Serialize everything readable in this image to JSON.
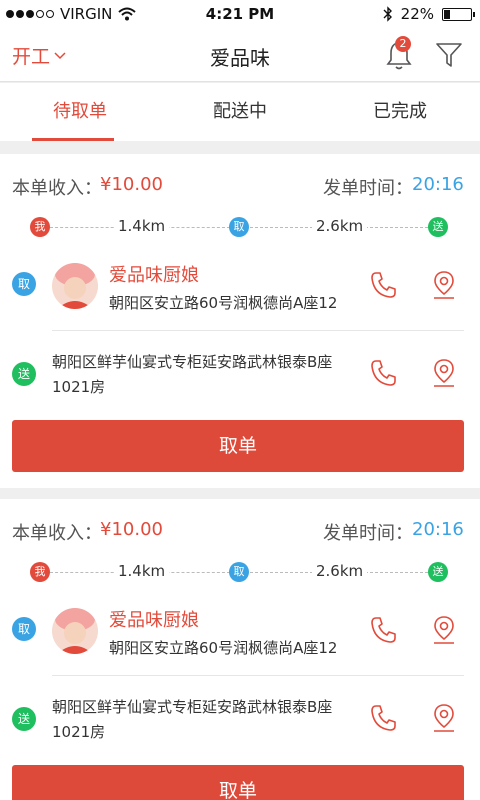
{
  "status_bar": {
    "carrier": "VIRGIN",
    "time": "4:21 PM",
    "battery": "22%",
    "battery_level": 0.22
  },
  "nav": {
    "left_label": "开工",
    "title": "爱品味",
    "notification_count": "2"
  },
  "tabs": [
    {
      "label": "待取单",
      "active": true
    },
    {
      "label": "配送中",
      "active": false
    },
    {
      "label": "已完成",
      "active": false
    }
  ],
  "orders": [
    {
      "income_label": "本单收入：",
      "income": "¥10.00",
      "time_label": "发单时间：",
      "time": "20:16",
      "route": {
        "me": "我",
        "pickup": "取",
        "deliver": "送",
        "dist1": "1.4km",
        "dist2": "2.6km"
      },
      "shop_name": "爱品味厨娘",
      "pickup_address": "朝阳区安立路60号润枫德尚A座12",
      "delivery_address_line1": "朝阳区鲜芋仙宴式专柜延安路武林银泰B座",
      "delivery_address_line2": "1021房",
      "button_label": "取单"
    },
    {
      "income_label": "本单收入：",
      "income": "¥10.00",
      "time_label": "发单时间：",
      "time": "20:16",
      "route": {
        "me": "我",
        "pickup": "取",
        "deliver": "送",
        "dist1": "1.4km",
        "dist2": "2.6km"
      },
      "shop_name": "爱品味厨娘",
      "pickup_address": "朝阳区安立路60号润枫德尚A座12",
      "delivery_address_line1": "朝阳区鲜芋仙宴式专柜延安路武林银泰B座",
      "delivery_address_line2": "1021房",
      "button_label": "取单"
    }
  ],
  "colors": {
    "accent": "#e24b3b",
    "blue": "#3aa3e3",
    "green": "#1fbf5f"
  },
  "icons": [
    "wifi-icon",
    "bluetooth-icon",
    "bell-icon",
    "filter-icon",
    "phone-icon",
    "location-pin-icon",
    "chevron-down-icon"
  ]
}
